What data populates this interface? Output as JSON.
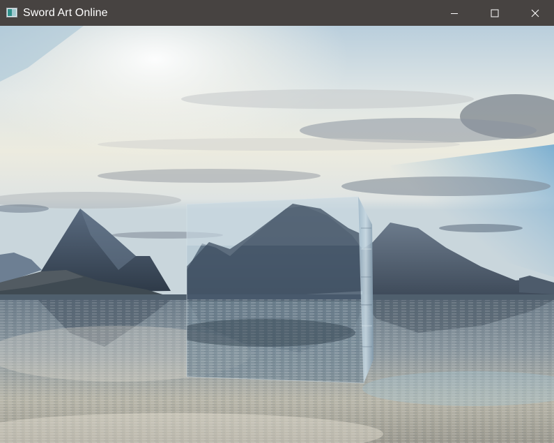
{
  "window": {
    "title": "Sword Art Online",
    "app_icon": "app-window-icon",
    "controls": {
      "minimize_icon": "minimize-icon",
      "maximize_icon": "maximize-icon",
      "close_icon": "close-icon"
    }
  },
  "scene": {
    "skybox_icon": "skybox",
    "object": "glass-cube",
    "colors": {
      "titlebar": "#474341",
      "sky_top": "#c9d8e2",
      "sky_haze": "#f4f1e6",
      "mountain": "#46576c",
      "water": "#7a8b97"
    }
  }
}
